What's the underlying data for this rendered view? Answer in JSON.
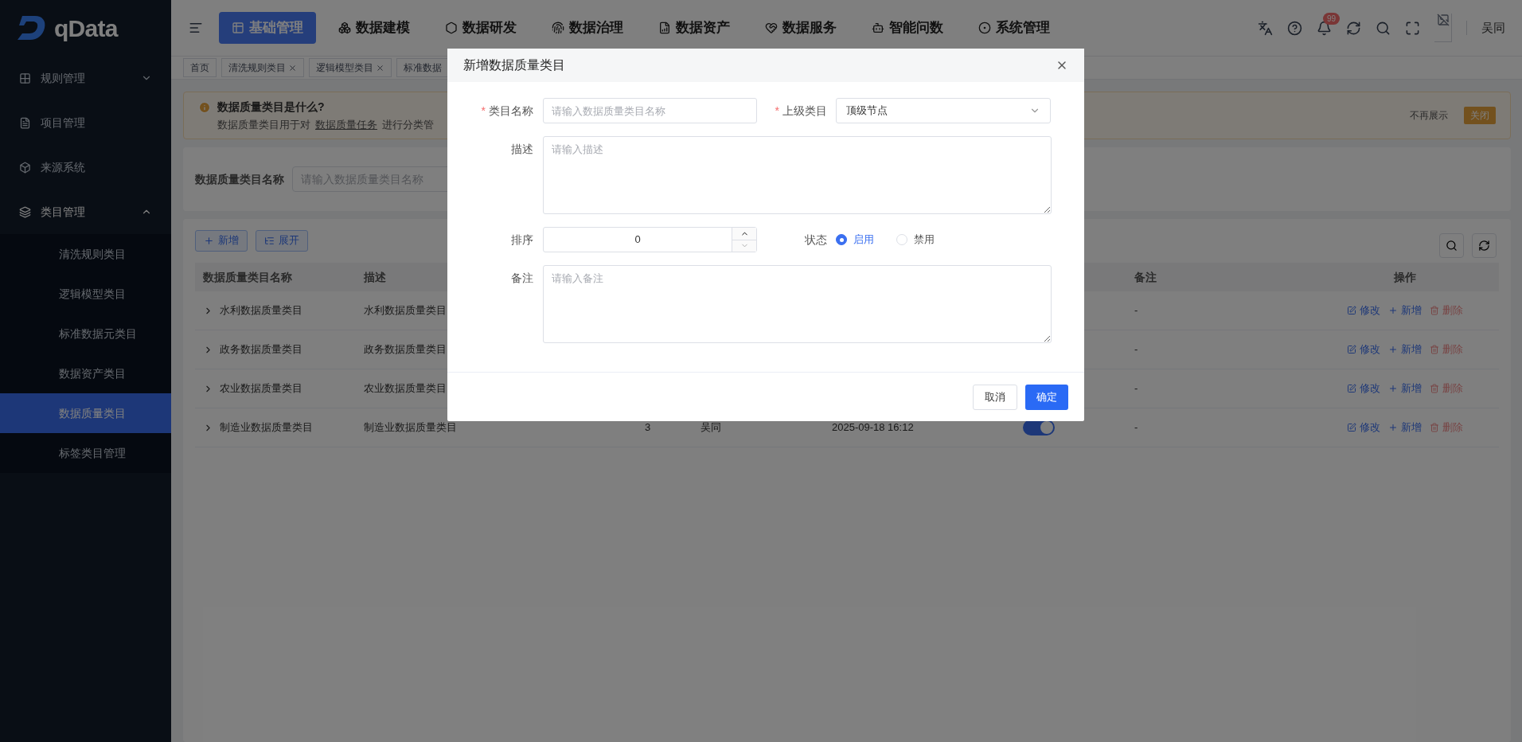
{
  "logo": {
    "text": "qData"
  },
  "top_nav": [
    {
      "label": "基础管理",
      "selected": true
    },
    {
      "label": "数据建模",
      "selected": false
    },
    {
      "label": "数据研发",
      "selected": false
    },
    {
      "label": "数据治理",
      "selected": false
    },
    {
      "label": "数据资产",
      "selected": false
    },
    {
      "label": "数据服务",
      "selected": false
    },
    {
      "label": "智能问数",
      "selected": false
    },
    {
      "label": "系统管理",
      "selected": false
    }
  ],
  "header_right": {
    "notification_badge": "99",
    "user": "吴同"
  },
  "sidebar": {
    "items": [
      {
        "label": "规则管理",
        "expanded": false
      },
      {
        "label": "项目管理"
      },
      {
        "label": "来源系统"
      },
      {
        "label": "类目管理",
        "expanded": true,
        "children": [
          {
            "label": "清洗规则类目",
            "selected": false
          },
          {
            "label": "逻辑模型类目",
            "selected": false
          },
          {
            "label": "标准数据元类目",
            "selected": false
          },
          {
            "label": "数据资产类目",
            "selected": false
          },
          {
            "label": "数据质量类目",
            "selected": true
          },
          {
            "label": "标签类目管理",
            "selected": false
          }
        ]
      }
    ]
  },
  "page_tabs": [
    {
      "label": "首页",
      "closable": false
    },
    {
      "label": "清洗规则类目",
      "closable": true
    },
    {
      "label": "逻辑模型类目",
      "closable": true
    },
    {
      "label": "标准数据",
      "closable": false
    }
  ],
  "alert": {
    "title": "数据质量类目是什么?",
    "body_before": "数据质量类目用于对",
    "link": "数据质量任务",
    "body_after": "进行分类管",
    "dismiss": "不再展示",
    "close": "关闭"
  },
  "search": {
    "label": "数据质量类目名称",
    "placeholder": "请输入数据质量类目名称"
  },
  "toolbar": [
    {
      "label": "新增"
    },
    {
      "label": "展开"
    }
  ],
  "table": {
    "columns": [
      "数据质量类目名称",
      "描述",
      "备注",
      "操作"
    ],
    "rows": [
      {
        "name": "水利数据质量类目",
        "description": "水利数据质量类目",
        "remark": "-",
        "actions": [
          {
            "label": "修改",
            "kind": "edit"
          },
          {
            "label": "新增",
            "kind": "add"
          },
          {
            "label": "删除",
            "kind": "delete"
          }
        ]
      },
      {
        "name": "政务数据质量类目",
        "description": "政务数据质量类目",
        "remark": "-",
        "actions": [
          {
            "label": "修改",
            "kind": "edit"
          },
          {
            "label": "新增",
            "kind": "add"
          },
          {
            "label": "删除",
            "kind": "delete"
          }
        ]
      },
      {
        "name": "农业数据质量类目",
        "description": "农业数据质量类目",
        "remark": "-",
        "actions": [
          {
            "label": "修改",
            "kind": "edit"
          },
          {
            "label": "新增",
            "kind": "add"
          },
          {
            "label": "删除",
            "kind": "delete"
          }
        ]
      },
      {
        "name": "制造业数据质量类目",
        "description": "制造业数据质量类目",
        "sort": "3",
        "creator": "吴同",
        "created_at": "2025-09-18 16:12",
        "status_on": true,
        "remark": "-",
        "actions": [
          {
            "label": "修改",
            "kind": "edit"
          },
          {
            "label": "新增",
            "kind": "add"
          },
          {
            "label": "删除",
            "kind": "delete"
          }
        ]
      }
    ]
  },
  "dialog": {
    "title": "新增数据质量类目",
    "name_field": {
      "label": "类目名称",
      "required_mark": "*",
      "placeholder": "请输入数据质量类目名称"
    },
    "parent_field": {
      "label": "上级类目",
      "required_mark": "*",
      "value": "顶级节点"
    },
    "description_field": {
      "label": "描述",
      "placeholder": "请输入描述"
    },
    "sort_field": {
      "label": "排序",
      "value": "0"
    },
    "status_field": {
      "label": "状态",
      "options": [
        {
          "label": "启用",
          "selected": true
        },
        {
          "label": "禁用",
          "selected": false
        }
      ]
    },
    "remark_field": {
      "label": "备注",
      "placeholder": "请输入备注"
    },
    "buttons": [
      {
        "label": "取消",
        "kind": "secondary"
      },
      {
        "label": "确定",
        "kind": "primary"
      }
    ]
  }
}
